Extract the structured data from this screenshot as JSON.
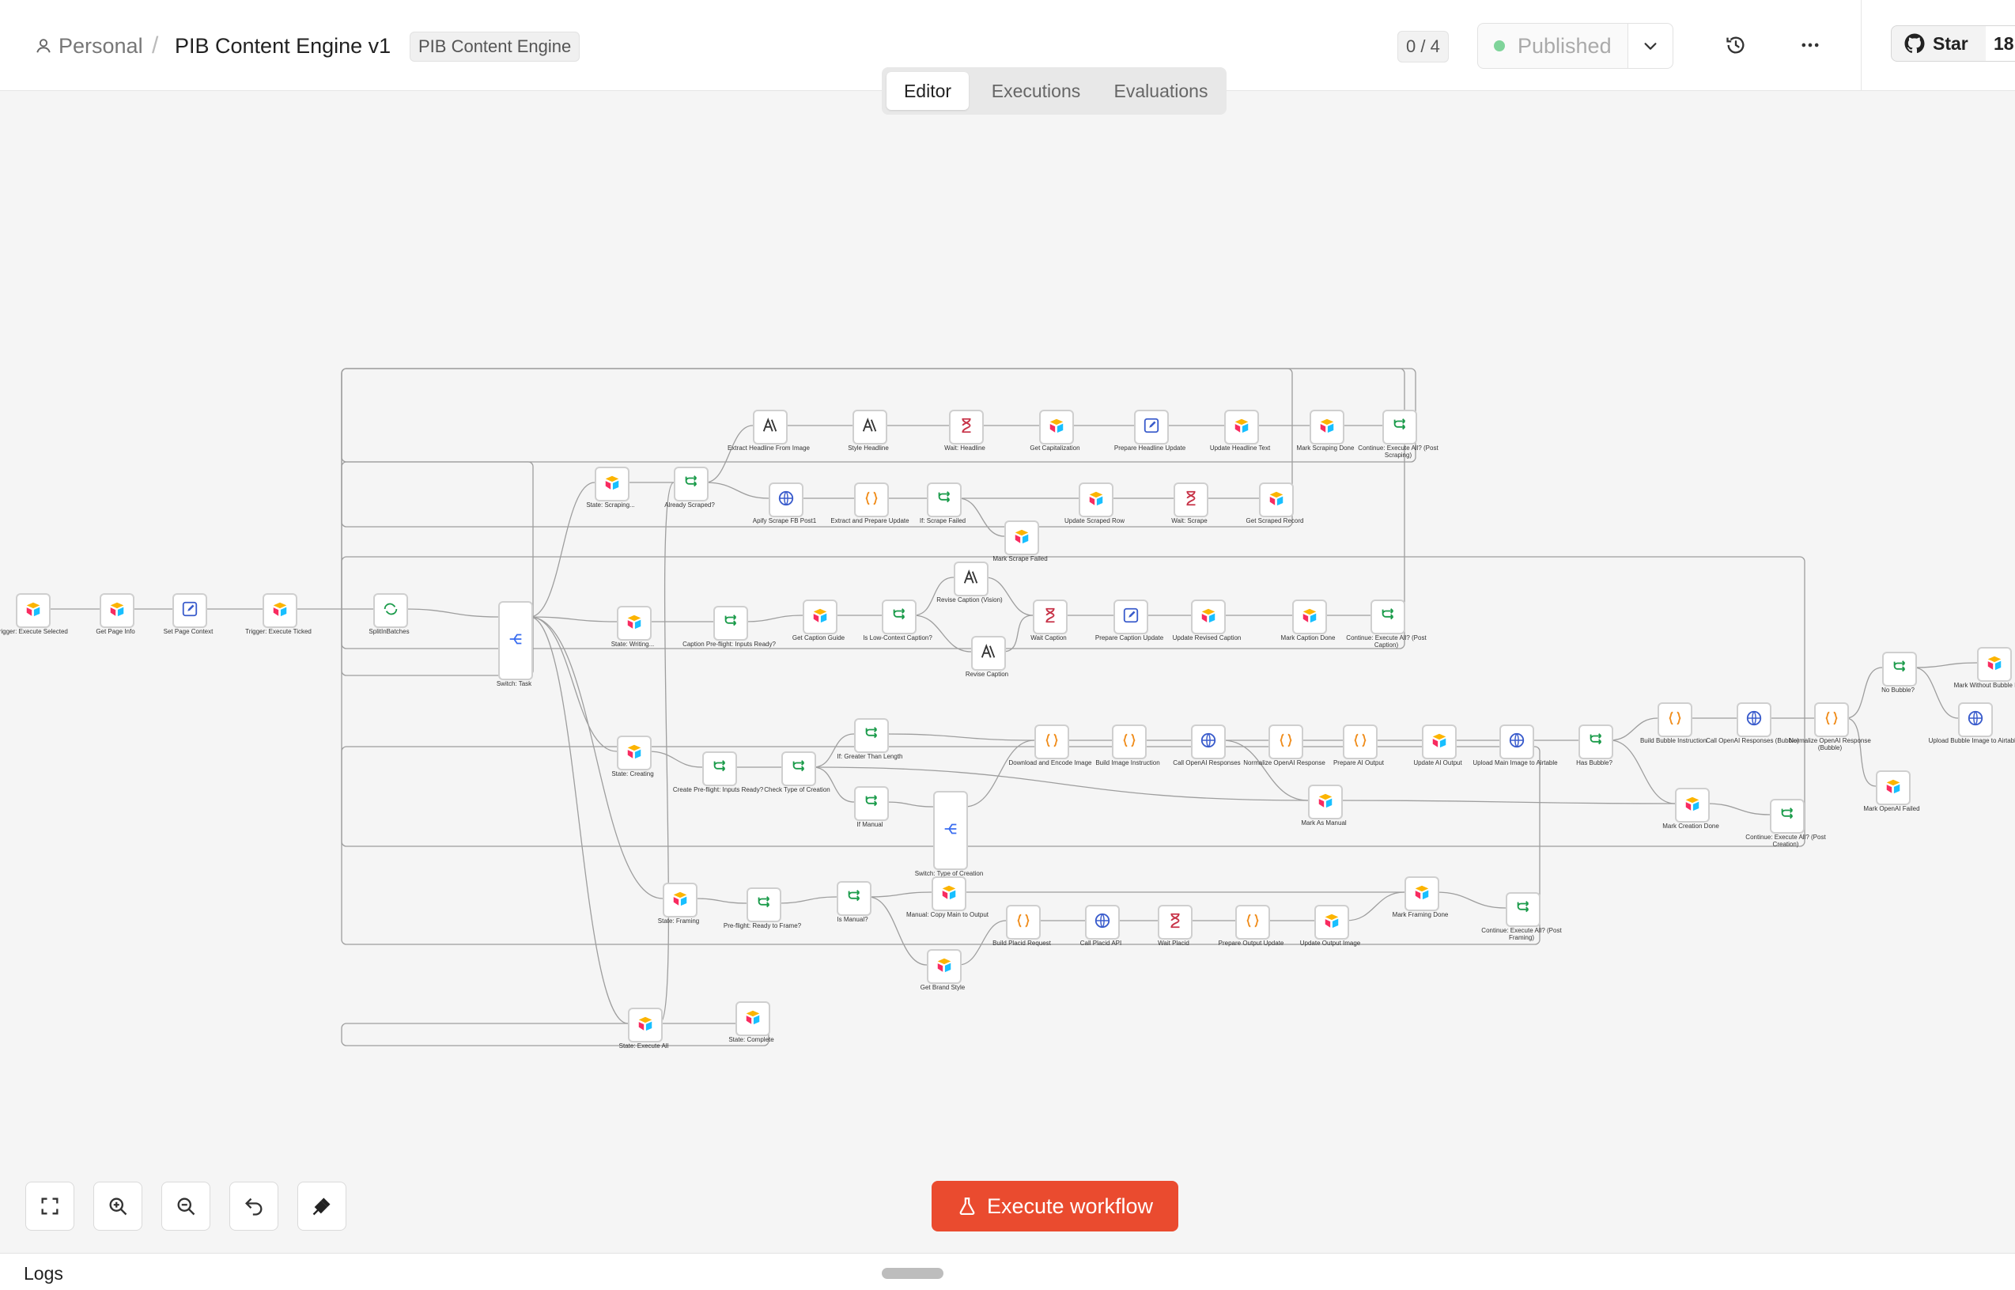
{
  "breadcrumb": {
    "owner": "Personal",
    "separator": "/",
    "workflow_name": "PIB Content Engine v1",
    "tag": "PIB Content Engine"
  },
  "header": {
    "counter": "0 / 4",
    "published_label": "Published",
    "star_label": "Star",
    "star_count": "18"
  },
  "tabs": {
    "editor": "Editor",
    "executions": "Executions",
    "evaluations": "Evaluations",
    "active": "Editor"
  },
  "footer": {
    "execute_label": "Execute workflow",
    "logs_label": "Logs"
  },
  "icons": {
    "zoom_fit": "fit-view-icon",
    "zoom_in": "zoom-in-icon",
    "zoom_out": "zoom-out-icon",
    "undo": "undo-icon",
    "tidy": "tidy-up-icon"
  },
  "colors": {
    "accent": "#ea4b2f",
    "published_dot": "#7fd49a"
  },
  "nodes": {
    "trigger_execute_selected": "Trigger: Execute Selected",
    "get_page_info": "Get Page Info",
    "set_page_context": "Set Page Context",
    "trigger_execute_ticked": "Trigger: Execute Ticked",
    "split_in_batches": "SplitInBatches",
    "switch_task": "Switch: Task",
    "state_scraping": "State: Scraping...",
    "already_scraped": "Already Scraped?",
    "extract_headline": "Extract Headline From Image",
    "style_headline": "Style Headline",
    "wait_headline": "Wait: Headline",
    "get_capitalization": "Get Capitalization",
    "prepare_headline_update": "Prepare Headline Update",
    "update_headline_text": "Update Headline Text",
    "mark_scraping_done": "Mark Scraping Done",
    "continue_post_scraping": "Continue: Execute All? (Post Scraping)",
    "apify_scrape": "Apify Scrape FB Post1",
    "extract_prepare_update": "Extract and Prepare Update",
    "if_scrape_failed": "If: Scrape Failed",
    "update_scraped_row": "Update Scraped Row",
    "wait_scrape": "Wait: Scrape",
    "get_scraped_record": "Get Scraped Record",
    "mark_scrape_failed": "Mark Scrape Failed",
    "state_writing": "State: Writing...",
    "caption_preflight": "Caption Pre-flight: Inputs Ready?",
    "get_caption_guide": "Get Caption Guide",
    "is_low_context": "Is Low-Context Caption?",
    "revise_caption_vision": "Revise Caption (Vision)",
    "revise_caption": "Revise Caption",
    "wait_caption": "Wait Caption",
    "prepare_caption_update": "Prepare Caption Update",
    "update_revised_caption": "Update Revised Caption",
    "mark_caption_done": "Mark Caption Done",
    "continue_post_caption": "Continue: Execute All? (Post Caption)",
    "state_creating": "State: Creating",
    "create_preflight": "Create Pre-flight: Inputs Ready?",
    "check_type_creation": "Check Type of Creation",
    "if_greater_length": "If: Greater Than Length",
    "if_manual": "If Manual",
    "switch_type_creation": "Switch: Type of Creation",
    "download_encode": "Download and Encode Image",
    "build_image_instruction": "Build Image Instruction",
    "call_openai_responses": "Call OpenAI Responses",
    "normalize_openai": "Normalize OpenAI Response",
    "prepare_ai_output": "Prepare AI Output",
    "update_ai_output": "Update AI Output",
    "upload_main_image": "Upload Main Image to Airtable",
    "has_bubble": "Has Bubble?",
    "build_bubble_instruction": "Build Bubble Instruction",
    "call_openai_bubble": "Call OpenAI Responses (Bubble)",
    "normalize_openai_bubble": "Normalize OpenAI Response (Bubble)",
    "no_bubble": "No Bubble?",
    "mark_without_bubble": "Mark Without Bubble Image",
    "upload_bubble_image": "Upload Bubble Image to Airtable",
    "mark_openai_failed": "Mark OpenAI Failed",
    "mark_as_manual": "Mark As Manual",
    "mark_creation_done": "Mark Creation Done",
    "continue_post_creation": "Continue: Execute All? (Post Creation)",
    "state_framing": "State: Framing",
    "preflight_ready_frame": "Pre-flight: Ready to Frame?",
    "is_manual": "Is Manual?",
    "manual_copy_main": "Manual: Copy Main to Output",
    "build_placid_request": "Build Placid Request",
    "call_placid_api": "Call Placid API",
    "wait_placid": "Wait Placid",
    "prepare_output_update": "Prepare Output Update",
    "update_output_image": "Update Output Image",
    "mark_framing_done": "Mark Framing Done",
    "continue_post_framing": "Continue: Execute All? (Post Framing)",
    "get_brand_style": "Get Brand Style",
    "state_complete": "State: Complete",
    "state_execute_all": "State: Execute All"
  }
}
